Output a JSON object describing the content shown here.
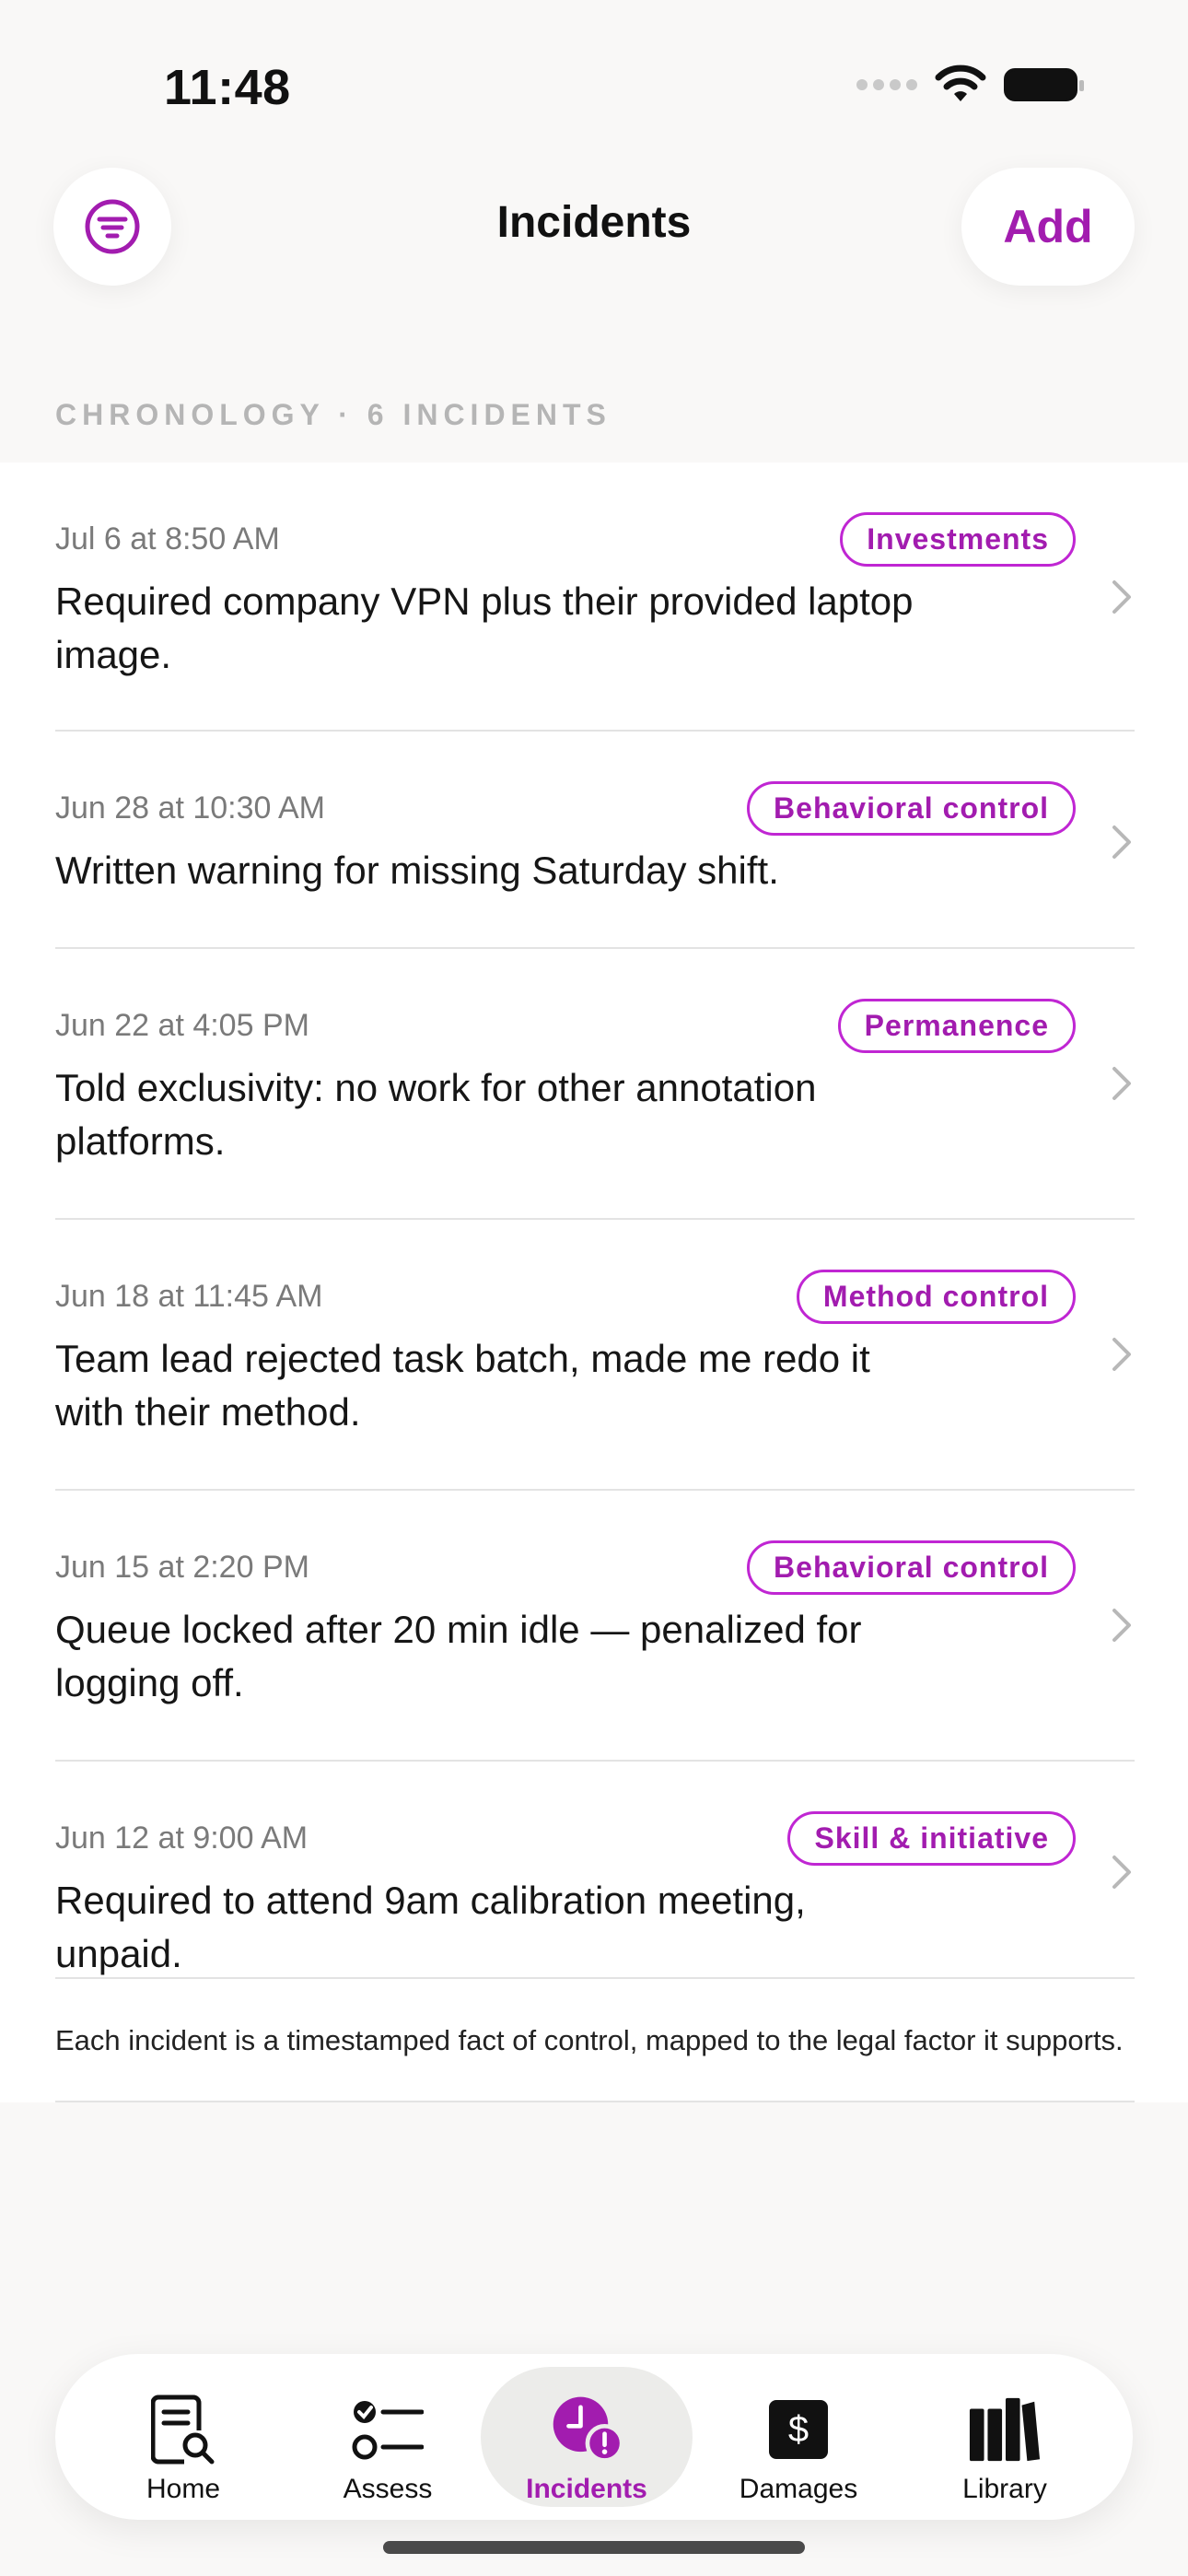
{
  "status": {
    "time": "11:48"
  },
  "header": {
    "title": "Incidents",
    "add_label": "Add"
  },
  "section": {
    "title": "CHRONOLOGY · 6 INCIDENTS"
  },
  "incidents": [
    {
      "date": "Jul 6 at 8:50 AM",
      "tag": "Investments",
      "text": "Required company VPN plus their provided laptop image."
    },
    {
      "date": "Jun 28 at 10:30 AM",
      "tag": "Behavioral control",
      "text": "Written warning for missing Saturday shift."
    },
    {
      "date": "Jun 22 at 4:05 PM",
      "tag": "Permanence",
      "text": "Told exclusivity: no work for other annotation platforms."
    },
    {
      "date": "Jun 18 at 11:45 AM",
      "tag": "Method control",
      "text": "Team lead rejected task batch, made me redo it with their method."
    },
    {
      "date": "Jun 15 at 2:20 PM",
      "tag": "Behavioral control",
      "text": "Queue locked after 20 min idle — penalized for logging off."
    },
    {
      "date": "Jun 12 at 9:00 AM",
      "tag": "Skill & initiative",
      "text": "Required to attend 9am calibration meeting, unpaid."
    }
  ],
  "footnote": "Each incident is a timestamped fact of control, mapped to the legal factor it supports.",
  "tabs": [
    {
      "label": "Home",
      "icon": "doc-search-icon"
    },
    {
      "label": "Assess",
      "icon": "checklist-icon"
    },
    {
      "label": "Incidents",
      "icon": "clock-alert-icon",
      "active": true
    },
    {
      "label": "Damages",
      "icon": "dollar-icon"
    },
    {
      "label": "Library",
      "icon": "books-icon"
    }
  ],
  "colors": {
    "accent": "#a21caf",
    "background": "#f9f8f7",
    "divider": "#e3e3e3"
  }
}
